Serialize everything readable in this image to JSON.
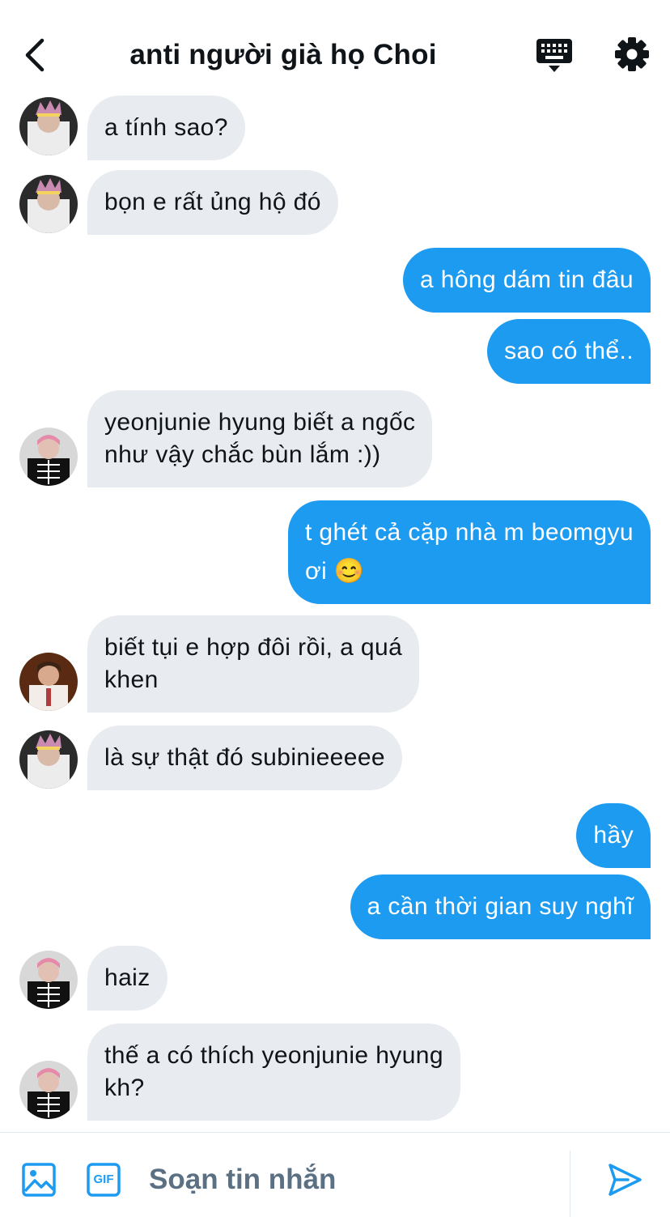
{
  "header": {
    "title": "anti người già họ Choi"
  },
  "messages": [
    {
      "side": "in",
      "avatar": "avatar-boy-crown",
      "text": "a tính sao?"
    },
    {
      "side": "in",
      "avatar": "avatar-boy-crown",
      "text": "bọn e rất ủng hộ đó"
    },
    {
      "side": "out",
      "text": "a hông dám tin đâu"
    },
    {
      "side": "out",
      "text": "sao có thể.."
    },
    {
      "side": "in",
      "avatar": "avatar-skeleton-shirt",
      "text": "yeonjunie hyung biết a ngốc\nnhư vậy chắc bùn lắm :))"
    },
    {
      "side": "out",
      "text": "t ghét cả cặp nhà m beomgyu\nơi 😊"
    },
    {
      "side": "in",
      "avatar": "avatar-boy-stage",
      "text": "biết tụi e hợp đôi rồi, a quá\nkhen"
    },
    {
      "side": "in",
      "avatar": "avatar-boy-crown",
      "text": "là sự thật đó subinieeeee"
    },
    {
      "side": "out",
      "text": "hầy"
    },
    {
      "side": "out",
      "text": "a cần thời gian suy nghĩ"
    },
    {
      "side": "in",
      "avatar": "avatar-skeleton-shirt",
      "text": "haiz"
    },
    {
      "side": "in",
      "avatar": "avatar-skeleton-shirt",
      "text": "thế a có thích yeonjunie hyung\nkh?"
    }
  ],
  "composer": {
    "placeholder": "Soạn tin nhắn",
    "gif_label": "GIF"
  },
  "colors": {
    "accent": "#1d9bf0",
    "incoming_bubble": "#e8ecf0",
    "placeholder": "#5b7083"
  }
}
